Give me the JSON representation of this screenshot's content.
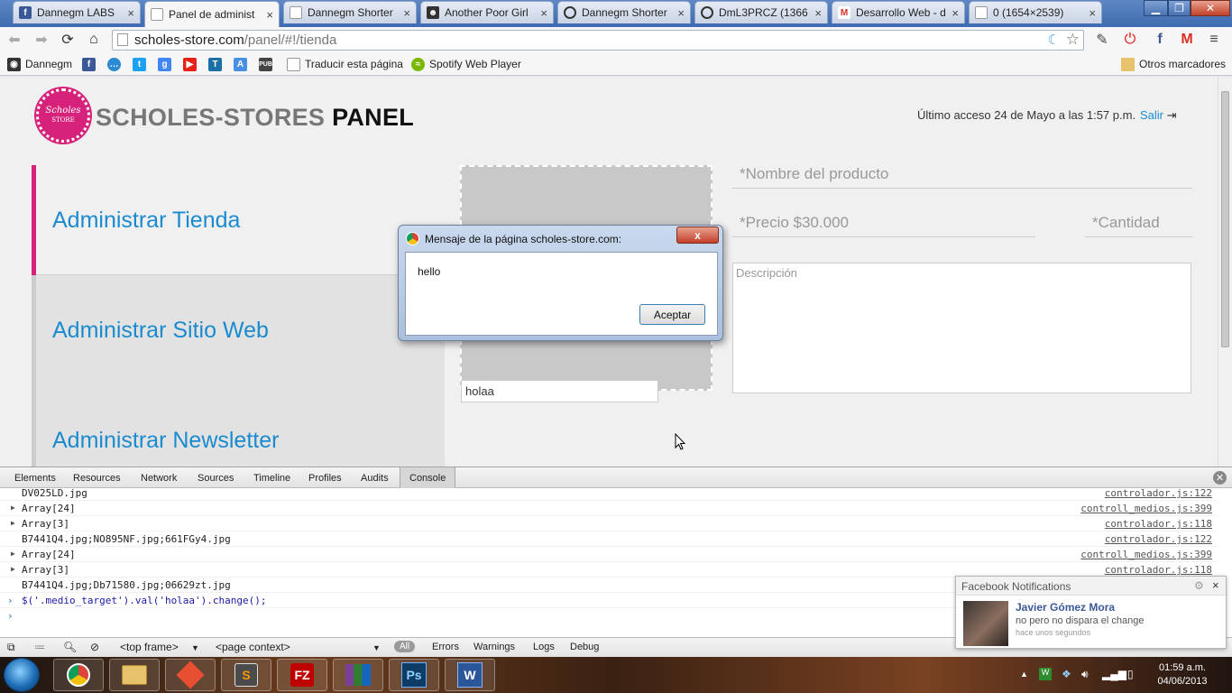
{
  "browser": {
    "tabs": [
      {
        "label": "Dannegm LABS",
        "icon": "facebook-icon",
        "color": "#3b5998"
      },
      {
        "label": "Panel de administ",
        "icon": "document-icon",
        "color": "#888888"
      },
      {
        "label": "Dannegm Shorter",
        "icon": "document-icon",
        "color": "#888888"
      },
      {
        "label": "Another Poor Girl",
        "icon": "face-icon",
        "color": "#333333"
      },
      {
        "label": "Dannegm Shorter",
        "icon": "spiral-icon",
        "color": "#333333"
      },
      {
        "label": "DmL3PRCZ (1366",
        "icon": "spiral-icon",
        "color": "#333333"
      },
      {
        "label": "Desarrollo Web - d",
        "icon": "gmail-icon",
        "color": "#d93025"
      },
      {
        "label": "0 (1654×2539)",
        "icon": "document-icon",
        "color": "#888888"
      }
    ],
    "url_host": "scholes-store.com",
    "url_path": "/panel/#!/tienda",
    "bookmarks": [
      {
        "label": "Dannegm",
        "icon": "github-icon",
        "color": "#333333"
      },
      {
        "label": "",
        "icon": "facebook-icon",
        "color": "#3b5998"
      },
      {
        "label": "",
        "icon": "chat-icon",
        "color": "#2a8ad4"
      },
      {
        "label": "",
        "icon": "twitter-icon",
        "color": "#1da1f2"
      },
      {
        "label": "",
        "icon": "google-plus-icon",
        "color": "#4285f4"
      },
      {
        "label": "",
        "icon": "youtube-icon",
        "color": "#e62117"
      },
      {
        "label": "",
        "icon": "tumblr-icon",
        "color": "#1b6fa8"
      },
      {
        "label": "",
        "icon": "translate-icon",
        "color": "#4a90e2"
      },
      {
        "label": "",
        "icon": "pub-icon",
        "color": "#444444"
      },
      {
        "label": "Traducir esta página",
        "icon": "document-icon",
        "color": "#888888"
      },
      {
        "label": "Spotify Web Player",
        "icon": "spotify-icon",
        "color": "#7ab800"
      }
    ],
    "other_bookmarks": "Otros marcadores"
  },
  "page": {
    "logo_text_1": "Scholes",
    "logo_text_2": "STORE",
    "brand_grey": "SCHOLES-STORES",
    "brand_bold": "PANEL",
    "last_access": "Último acceso 24 de Mayo a las 1:57 p.m.",
    "logout": "Salir",
    "nav": [
      "Administrar Tienda",
      "Administrar Sitio Web",
      "Administrar Newsletter"
    ],
    "media_input_value": "holaa",
    "fields": {
      "product_name": "*Nombre del producto",
      "price": "*Precio $30.000",
      "quantity": "*Cantidad",
      "description": "Descripción"
    },
    "accent_color": "#d6227a",
    "link_color": "#1b8bd0"
  },
  "dialog": {
    "title": "Mensaje de la página scholes-store.com:",
    "message": "hello",
    "ok": "Aceptar",
    "close": "x"
  },
  "devtools": {
    "tabs": [
      "Elements",
      "Resources",
      "Network",
      "Sources",
      "Timeline",
      "Profiles",
      "Audits",
      "Console"
    ],
    "active_tab": "Console",
    "rows": [
      {
        "text": "DV025LD.jpg",
        "source": "controlador.js:122",
        "expandable": false
      },
      {
        "text": "Array[24]",
        "source": "controll_medios.js:399",
        "expandable": true
      },
      {
        "text": "Array[3]",
        "source": "controlador.js:118",
        "expandable": true
      },
      {
        "text": "B7441Q4.jpg;NO895NF.jpg;661FGy4.jpg",
        "source": "controlador.js:122",
        "expandable": false
      },
      {
        "text": "Array[24]",
        "source": "controll_medios.js:399",
        "expandable": true
      },
      {
        "text": "Array[3]",
        "source": "controlador.js:118",
        "expandable": true
      },
      {
        "text": "B7441Q4.jpg;Db71580.jpg;06629zt.jpg",
        "source": "",
        "expandable": false
      }
    ],
    "command": "$('.medio_target').val('holaa').change();",
    "frame": "<top frame>",
    "context": "<page context>",
    "filters": [
      "All",
      "Errors",
      "Warnings",
      "Logs",
      "Debug"
    ]
  },
  "notification": {
    "title": "Facebook Notifications",
    "name": "Javier Gómez Mora",
    "message": "no pero no dispara el change",
    "time": "hace unos segundos"
  },
  "taskbar": {
    "apps": [
      {
        "label": "",
        "icon": "chrome-icon",
        "color": "#db4437"
      },
      {
        "label": "",
        "icon": "folder-icon",
        "color": "#e8c26a"
      },
      {
        "label": "",
        "icon": "git-icon",
        "color": "#e84e31"
      },
      {
        "label": "S",
        "icon": "sublime-icon",
        "color": "#4b4b4b"
      },
      {
        "label": "FZ",
        "icon": "filezilla-icon",
        "color": "#bf0000"
      },
      {
        "label": "",
        "icon": "winrar-icon",
        "color": "#7b3f98"
      },
      {
        "label": "Ps",
        "icon": "photoshop-icon",
        "color": "#0d3c66"
      },
      {
        "label": "W",
        "icon": "word-icon",
        "color": "#2b579a"
      }
    ],
    "time": "01:59 a.m.",
    "date": "04/06/2013"
  }
}
